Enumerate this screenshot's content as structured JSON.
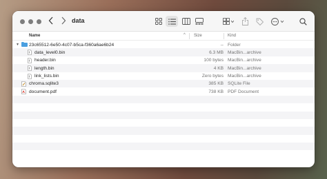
{
  "window": {
    "title": "data"
  },
  "toolbar": {
    "back_icon": "chevron-left-icon",
    "forward_icon": "chevron-right-icon",
    "view_buttons": [
      "icon-view-icon",
      "list-view-icon",
      "column-view-icon",
      "gallery-view-icon"
    ],
    "selected_view": "list-view-icon",
    "actions": [
      "group-icon",
      "share-icon",
      "tag-icon",
      "more-icon",
      "search-icon"
    ]
  },
  "columns": {
    "name": "Name",
    "size": "Size",
    "kind": "Kind"
  },
  "files": [
    {
      "name": "23c65512-6e50-4c07-b5ca-f360a6ae6b24",
      "size": "--",
      "kind": "Folder",
      "icon": "folder-icon",
      "expanded": true,
      "indent": 0
    },
    {
      "name": "data_level0.bin",
      "size": "6.3 MB",
      "kind": "MacBin...archive",
      "icon": "document-icon",
      "indent": 1
    },
    {
      "name": "header.bin",
      "size": "100 bytes",
      "kind": "MacBin...archive",
      "icon": "document-icon",
      "indent": 1
    },
    {
      "name": "length.bin",
      "size": "4 KB",
      "kind": "MacBin...archive",
      "icon": "document-icon",
      "indent": 1
    },
    {
      "name": "link_lists.bin",
      "size": "Zero bytes",
      "kind": "MacBin...archive",
      "icon": "document-icon",
      "indent": 1
    },
    {
      "name": "chroma.sqlite3",
      "size": "385 KB",
      "kind": "SQLite File",
      "icon": "sqlite-file-icon",
      "indent": 0
    },
    {
      "name": "document.pdf",
      "size": "738 KB",
      "kind": "PDF Document",
      "icon": "pdf-icon",
      "indent": 0
    }
  ],
  "colors": {
    "folder": "#4a9fe0",
    "pdf": "#d9362b",
    "selected_view_bg": "#e3e3e3"
  }
}
